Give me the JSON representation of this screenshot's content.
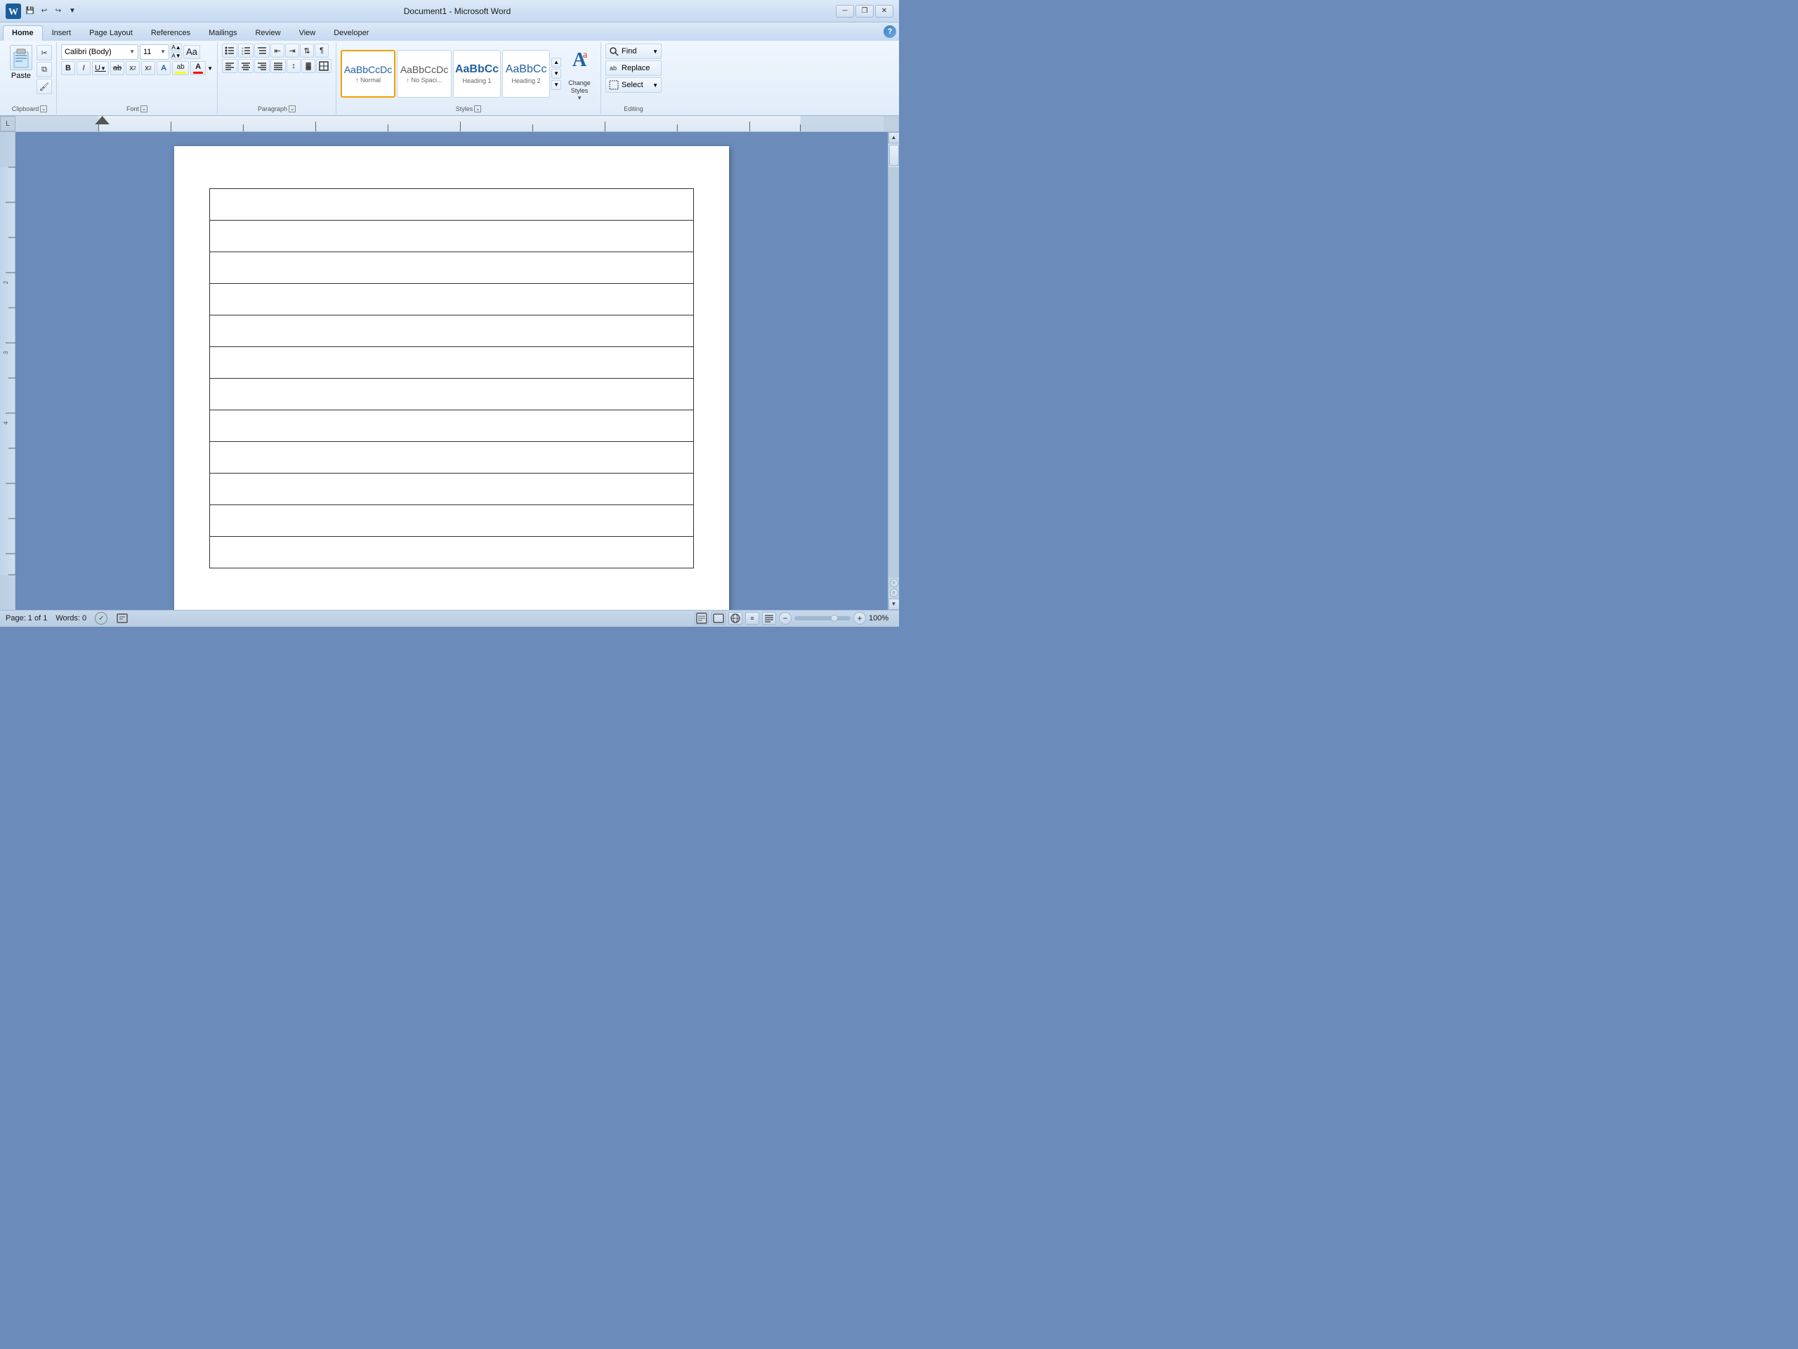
{
  "window": {
    "title": "Document1 - Microsoft Word",
    "app_icon": "W",
    "minimize": "─",
    "restore": "❐",
    "close": "✕"
  },
  "quick_access": {
    "save": "💾",
    "undo": "↩",
    "redo": "↪",
    "dropdown": "▼"
  },
  "tabs": [
    {
      "label": "Home",
      "active": true
    },
    {
      "label": "Insert",
      "active": false
    },
    {
      "label": "Page Layout",
      "active": false
    },
    {
      "label": "References",
      "active": false
    },
    {
      "label": "Mailings",
      "active": false
    },
    {
      "label": "Review",
      "active": false
    },
    {
      "label": "View",
      "active": false
    },
    {
      "label": "Developer",
      "active": false
    }
  ],
  "ribbon": {
    "clipboard": {
      "label": "Clipboard",
      "paste_label": "Paste",
      "cut_icon": "✂",
      "copy_icon": "⧉",
      "format_painter_icon": "🖌"
    },
    "font": {
      "label": "Font",
      "font_name": "Calibri (Body)",
      "font_size": "11",
      "grow": "A",
      "shrink": "A",
      "clear_format": "A",
      "bold": "B",
      "italic": "I",
      "underline": "U",
      "strikethrough": "ab",
      "subscript": "x",
      "superscript": "x",
      "text_effects": "A",
      "highlight": "ab",
      "font_color": "A"
    },
    "paragraph": {
      "label": "Paragraph",
      "bullets": "☰",
      "numbering": "☰",
      "multilevel": "☰",
      "decrease_indent": "⇤",
      "increase_indent": "⇥",
      "sort": "⇅",
      "show_hide": "¶",
      "align_left": "≡",
      "align_center": "≡",
      "align_right": "≡",
      "justify": "≡",
      "line_spacing": "↕",
      "shading": "▓",
      "borders": "⊞"
    },
    "styles": {
      "label": "Styles",
      "normal_label": "↑ Normal",
      "no_spacing_label": "↑ No Spaci...",
      "heading1_label": "Heading 1",
      "heading2_label": "Heading 2",
      "scroll_up": "▲",
      "scroll_down": "▼",
      "more": "▼",
      "change_styles_label": "Change\nStyles",
      "expand_icon": "⌄"
    },
    "editing": {
      "label": "Editing",
      "find_label": "Find",
      "replace_label": "Replace",
      "select_label": "Select",
      "find_arrow": "▼",
      "replace_arrow": "",
      "select_arrow": "▼"
    }
  },
  "ruler": {
    "tab_selector": "L",
    "scroll_right": "▶"
  },
  "document": {
    "table_rows": 12,
    "table_cols": 1
  },
  "status_bar": {
    "page_info": "Page: 1 of 1",
    "words": "Words: 0",
    "spell_check": "✓",
    "view_print": "📄",
    "zoom_percent": "100%",
    "zoom_minus": "−",
    "zoom_plus": "+"
  },
  "colors": {
    "accent": "#2060a0",
    "ribbon_bg": "#e0ecf8",
    "active_tab_bg": "#e8f0fc",
    "normal_style_border": "#f0a000",
    "highlight_yellow": "#ffff00",
    "font_color_red": "#ff0000"
  }
}
